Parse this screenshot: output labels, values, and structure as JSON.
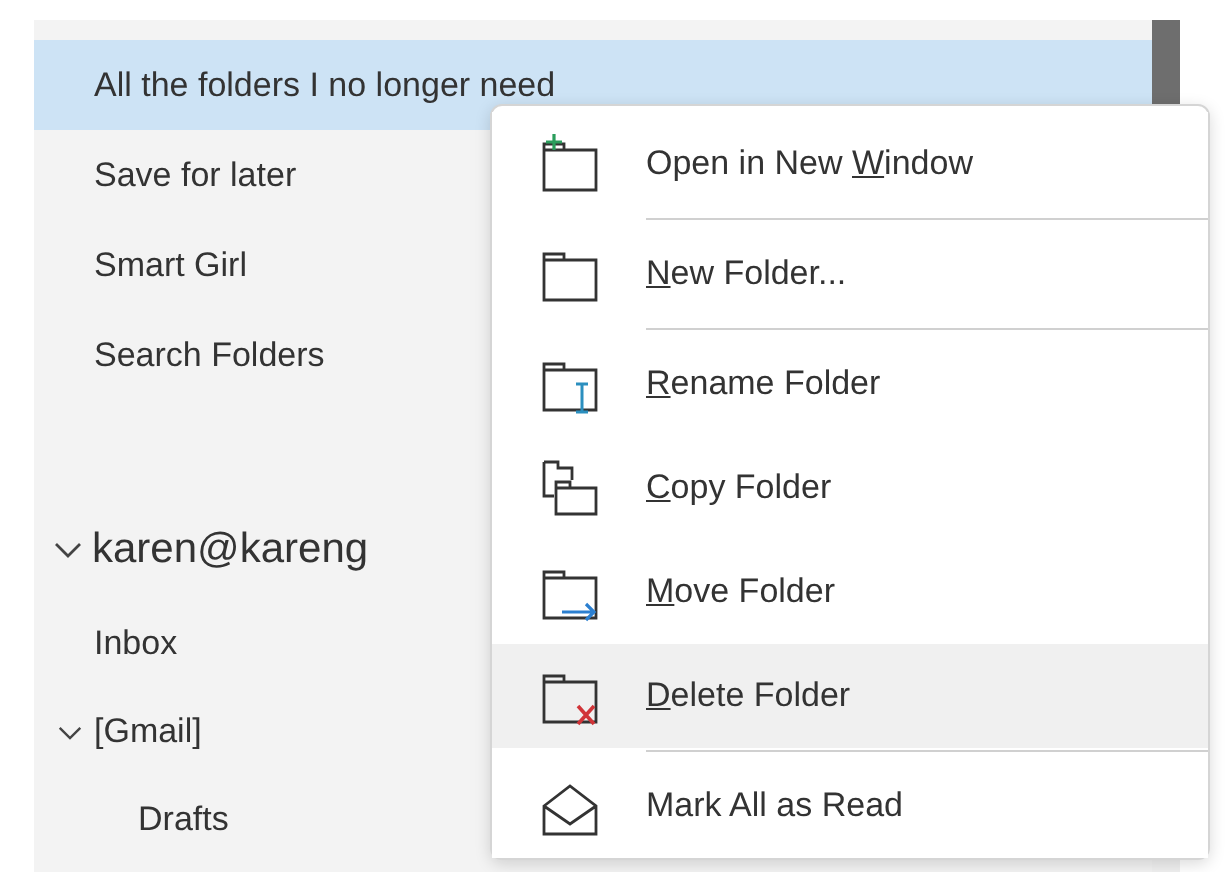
{
  "folder_pane": {
    "folders": [
      {
        "label": "All the folders I no longer need",
        "selected": true
      },
      {
        "label": "Save for later",
        "selected": false
      },
      {
        "label": "Smart Girl",
        "selected": false
      },
      {
        "label": "Search Folders",
        "selected": false
      }
    ],
    "account": {
      "name": "karen@kareng",
      "expanded": true,
      "children": [
        {
          "label": "Inbox",
          "selected": false
        },
        {
          "label": "[Gmail]",
          "selected": false,
          "expanded": true,
          "children": [
            {
              "label": "Drafts",
              "selected": false
            }
          ]
        }
      ]
    }
  },
  "context_menu": {
    "items": [
      {
        "label_parts": [
          {
            "text": "Open in New ",
            "underlined": false
          },
          {
            "text": "W",
            "underlined": true
          },
          {
            "text": "indow",
            "underlined": false
          }
        ],
        "selected": false,
        "separator_after": true
      },
      {
        "label_parts": [
          {
            "text": "N",
            "underlined": true
          },
          {
            "text": "ew Folder...",
            "underlined": false
          }
        ],
        "selected": false,
        "separator_after": true
      },
      {
        "label_parts": [
          {
            "text": "R",
            "underlined": true
          },
          {
            "text": "ename Folder",
            "underlined": false
          }
        ],
        "selected": false,
        "separator_after": false
      },
      {
        "label_parts": [
          {
            "text": "C",
            "underlined": true
          },
          {
            "text": "opy Folder",
            "underlined": false
          }
        ],
        "selected": false,
        "separator_after": false
      },
      {
        "label_parts": [
          {
            "text": "M",
            "underlined": true
          },
          {
            "text": "ove Folder",
            "underlined": false
          }
        ],
        "selected": false,
        "separator_after": false
      },
      {
        "label_parts": [
          {
            "text": "D",
            "underlined": true
          },
          {
            "text": "elete Folder",
            "underlined": false
          }
        ],
        "selected": true,
        "separator_after": true
      },
      {
        "label_parts": [
          {
            "text": "Mark All as Read",
            "underlined": false
          }
        ],
        "selected": false,
        "separator_after": false
      }
    ]
  }
}
